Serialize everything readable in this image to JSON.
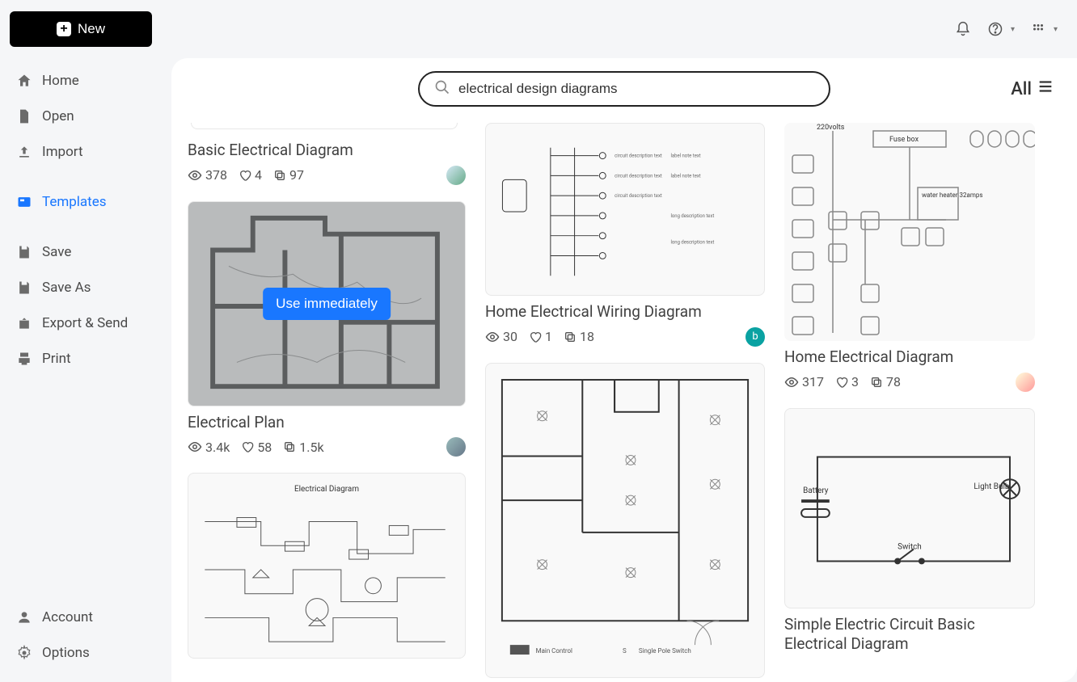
{
  "header": {
    "new_label": "New"
  },
  "sidebar": {
    "items": [
      {
        "label": "Home",
        "id": "home"
      },
      {
        "label": "Open",
        "id": "open"
      },
      {
        "label": "Import",
        "id": "import"
      },
      {
        "label": "Templates",
        "id": "templates",
        "active": true
      },
      {
        "label": "Save",
        "id": "save"
      },
      {
        "label": "Save As",
        "id": "saveas"
      },
      {
        "label": "Export & Send",
        "id": "export"
      },
      {
        "label": "Print",
        "id": "print"
      }
    ],
    "bottom": [
      {
        "label": "Account",
        "id": "account"
      },
      {
        "label": "Options",
        "id": "options"
      }
    ]
  },
  "search": {
    "value": "electrical design diagrams",
    "filter_label": "All"
  },
  "hover_action": "Use immediately",
  "cards": {
    "basic": {
      "title": "Basic Electrical Diagram",
      "views": "378",
      "likes": "4",
      "copies": "97"
    },
    "plan": {
      "title": "Electrical Plan",
      "views": "3.4k",
      "likes": "58",
      "copies": "1.5k"
    },
    "wiring": {
      "title": "Home Electrical Wiring Diagram",
      "views": "30",
      "likes": "1",
      "copies": "18",
      "avatar_letter": "b"
    },
    "home": {
      "title": "Home Electrical Diagram",
      "views": "317",
      "likes": "3",
      "copies": "78"
    },
    "simple": {
      "title": "Simple Electric Circuit Basic Electrical Diagram"
    },
    "schematic_label": "Electrical\nDiagram",
    "home_labels": {
      "volt": "220volts",
      "fuse": "Fuse box",
      "heater": "water\nheater\n32amps"
    },
    "circuit_labels": {
      "battery": "Battery",
      "bulb": "Light Bulb",
      "switch": "Switch"
    }
  }
}
